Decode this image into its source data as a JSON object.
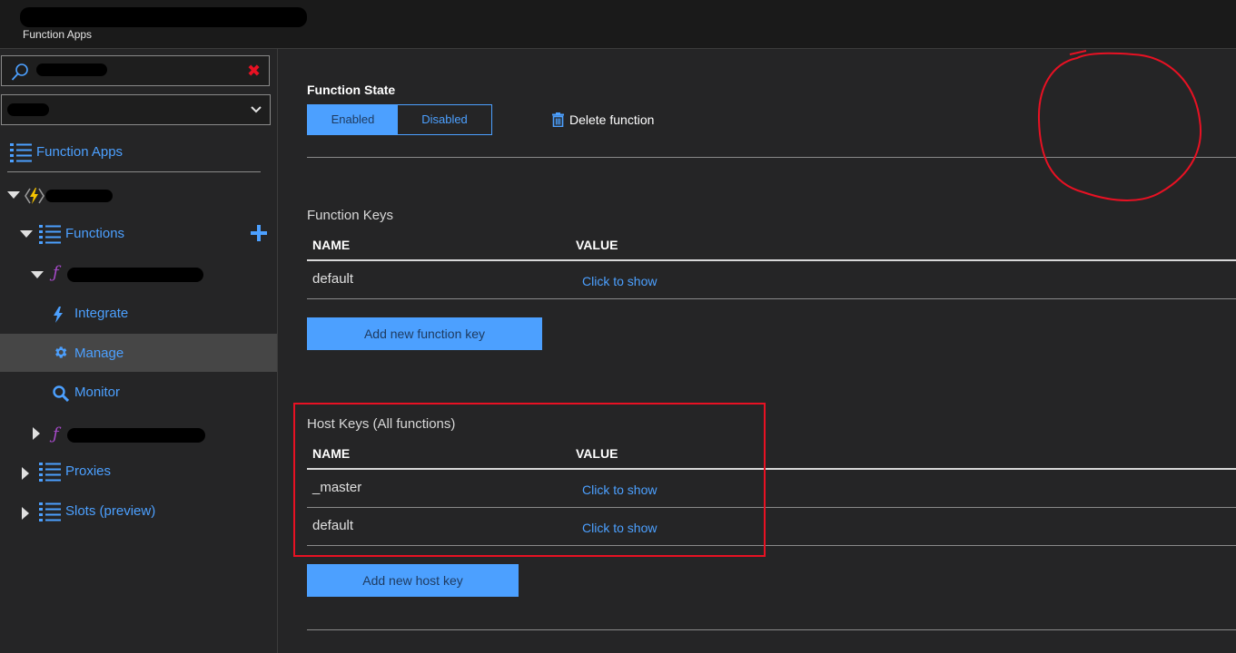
{
  "header": {
    "subtitle": "Function Apps"
  },
  "sidebar": {
    "search": {
      "value": ""
    },
    "subscription": {
      "value": ""
    },
    "items": [
      {
        "label": "Function Apps"
      },
      {
        "label": "Functions"
      },
      {
        "label": "Integrate"
      },
      {
        "label": "Manage"
      },
      {
        "label": "Monitor"
      },
      {
        "label": "Proxies"
      },
      {
        "label": "Slots (preview)"
      }
    ]
  },
  "main": {
    "function_state": {
      "title": "Function State",
      "enabled_label": "Enabled",
      "disabled_label": "Disabled",
      "selected": "Enabled"
    },
    "delete_label": "Delete function",
    "function_keys": {
      "title": "Function Keys",
      "columns": [
        "NAME",
        "VALUE"
      ],
      "rows": [
        {
          "name": "default",
          "value": "Click to show"
        }
      ],
      "add_label": "Add new function key"
    },
    "host_keys": {
      "title": "Host Keys (All functions)",
      "columns": [
        "NAME",
        "VALUE"
      ],
      "rows": [
        {
          "name": "_master",
          "value": "Click to show"
        },
        {
          "name": "default",
          "value": "Click to show"
        }
      ],
      "add_label": "Add new host key"
    }
  },
  "colors": {
    "accent": "#4ca0ff",
    "background": "#252526",
    "annotation": "#e81123"
  }
}
